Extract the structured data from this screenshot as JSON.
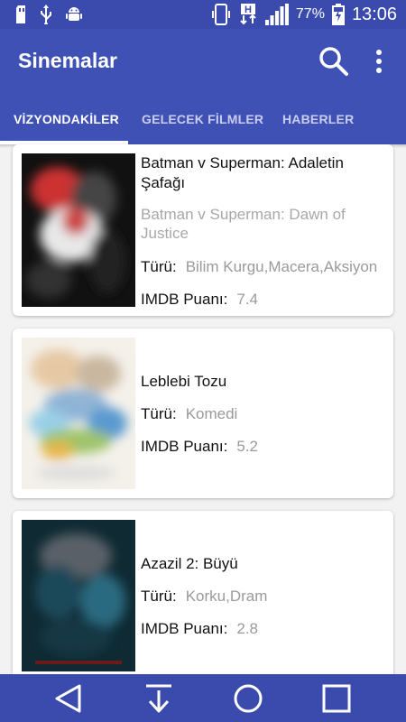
{
  "status_bar": {
    "battery_percent": "77%",
    "time": "13:06",
    "network_type": "H"
  },
  "app_bar": {
    "title": "Sinemalar",
    "search_icon": "search-icon",
    "more_icon": "more-vert-icon"
  },
  "tabs": [
    {
      "label": "VİZYONDAKİLER",
      "active": true
    },
    {
      "label": "GELECEK FİLMLER",
      "active": false
    },
    {
      "label": "HABERLER",
      "active": false
    }
  ],
  "movies": [
    {
      "title": "Batman v Superman: Adaletin Şafağı",
      "original_title": "Batman v Superman: Dawn of Justice",
      "genre_label": "Türü:",
      "genre": "Bilim Kurgu,Macera,Aksiyon",
      "imdb_label": "IMDB Puanı:",
      "imdb": "7.4"
    },
    {
      "title": "Leblebi Tozu",
      "genre_label": "Türü:",
      "genre": "Komedi",
      "imdb_label": "IMDB Puanı:",
      "imdb": "5.2"
    },
    {
      "title": "Azazil 2: Büyü",
      "genre_label": "Türü:",
      "genre": "Korku,Dram",
      "imdb_label": "IMDB Puanı:",
      "imdb": "2.8"
    }
  ],
  "nav_bar": {
    "back_icon": "back-icon",
    "notification_icon": "download-icon",
    "home_icon": "home-icon",
    "recents_icon": "recents-icon"
  },
  "colors": {
    "primary": "#3f51b5",
    "status": "#3a4bad",
    "muted_text": "#9a9a9a"
  }
}
